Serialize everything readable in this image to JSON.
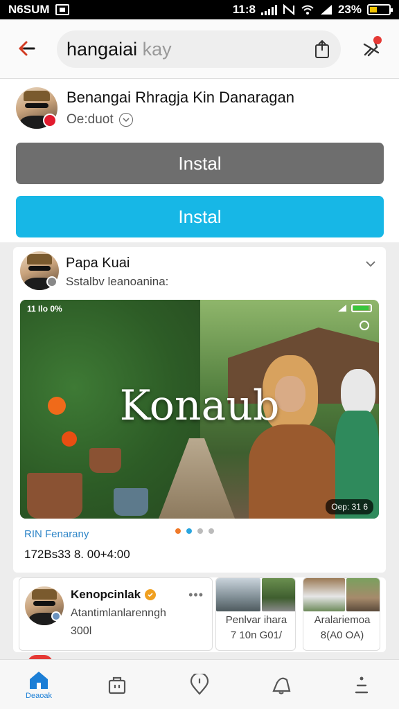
{
  "status_bar": {
    "carrier": "N6SUM",
    "time": "11:8",
    "battery_percent": "23%"
  },
  "search": {
    "query": "hangaiai",
    "suffix": "kay"
  },
  "page": {
    "name": "Benangai Rhragja Kin Danaragan",
    "subtitle": "Oe:duot"
  },
  "buttons": {
    "install_gray": "Instal",
    "install_blue": "Instal"
  },
  "post": {
    "author": "Papa Kuai",
    "subtitle": "Sstalbv leanoanina:",
    "media": {
      "overlay_text": "Konaub",
      "status_left": "11 Ilo 0%",
      "duration": "Oep: 31 6"
    },
    "caption": "RIN Fenarany",
    "date": "172Bs33 8. 00+4:00",
    "carousel": {
      "count": 4,
      "active_index": 1
    }
  },
  "suggestions": {
    "main": {
      "name": "Kenopcinlak",
      "description": "Atantimlanlarenngh",
      "count": "300l"
    },
    "tiles": [
      {
        "caption": "Penlvar ihara",
        "count": "7 10n G01/"
      },
      {
        "caption": "Aralariemoa",
        "count": "8(A0 OA)"
      }
    ]
  },
  "bottom_nav": {
    "home_label": "Deaoak"
  },
  "colors": {
    "accent_blue": "#17b7e6",
    "button_gray": "#6e6e6e",
    "link_blue": "#2f86c8",
    "badge_red": "#e21b2e"
  }
}
